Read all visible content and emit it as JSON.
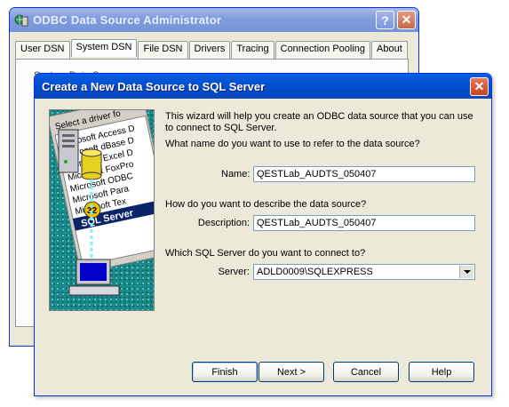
{
  "back_window": {
    "title": "ODBC Data Source Administrator",
    "tabs": [
      "User DSN",
      "System DSN",
      "File DSN",
      "Drivers",
      "Tracing",
      "Connection Pooling",
      "About"
    ],
    "active_tab": "System DSN",
    "panel_fragment": "System Data S..."
  },
  "dialog": {
    "title": "Create a New Data Source to SQL Server",
    "intro": "This wizard will help you create an ODBC data source that you can use to connect to SQL Server.",
    "name_question": "What name do you want to use to refer to the data source?",
    "name_label": "Name:",
    "name_value": "QESTLab_AUDTS_050407",
    "description_question": "How do you want to describe the data source?",
    "description_label": "Description:",
    "description_value": "QESTLab_AUDTS_050407",
    "server_question": "Which SQL Server do you want to connect to?",
    "server_label": "Server:",
    "server_value": "ADLD0009\\SQLEXPRESS",
    "buttons": {
      "finish": "Finish",
      "next": "Next >",
      "cancel": "Cancel",
      "help": "Help"
    }
  },
  "wizard_art": {
    "heading": "Select a driver fo",
    "drivers": [
      "Microsoft Access D",
      "Microsoft dBase D",
      "Microsoft Excel D",
      "Microsoft FoxPro",
      "Microsoft ODBC",
      "Microsoft Para",
      "Microsoft Tex"
    ],
    "selected": "SQL Server",
    "badge": "32"
  },
  "colors": {
    "dialog_titlebar": "#0453d6",
    "inactive_titlebar": "#7e9bdc",
    "window_face": "#ece9d8",
    "close_button": "#c8401f",
    "art_background": "#1b8a8a"
  },
  "icons": [
    "odbc-app-icon",
    "help-icon",
    "close-icon",
    "dropdown-arrow-icon",
    "server-icon",
    "database-cylinder-icon",
    "computer-icon"
  ]
}
